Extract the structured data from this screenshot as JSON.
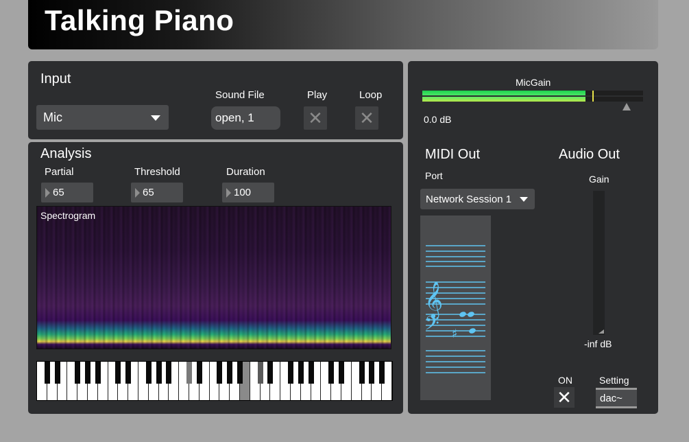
{
  "app": {
    "title": "Talking Piano"
  },
  "input": {
    "heading": "Input",
    "source_value": "Mic",
    "sound_file_label": "Sound File",
    "sound_file_value": "open, 1",
    "play_label": "Play",
    "loop_label": "Loop"
  },
  "analysis": {
    "heading": "Analysis",
    "partial_label": "Partial",
    "partial_value": "65",
    "threshold_label": "Threshold",
    "threshold_value": "65",
    "duration_label": "Duration",
    "duration_value": "100",
    "spectrogram_label": "Spectrogram"
  },
  "mic": {
    "label": "MicGain",
    "readout": "0.0 dB",
    "level": 0.74
  },
  "midi_out": {
    "heading": "MIDI Out",
    "port_label": "Port",
    "port_value": "Network Session 1"
  },
  "audio_out": {
    "heading": "Audio Out",
    "gain_label": "Gain",
    "gain_readout": "-inf dB",
    "on_label": "ON",
    "setting_label": "Setting",
    "setting_value": "dac~"
  },
  "colors": {
    "panel": "#2c2d2f",
    "background": "#a4a4a4",
    "meter_green": "#1dd14f",
    "staff_blue": "#5fc4f2"
  },
  "icons": {
    "dropdown": "chevron-down-icon",
    "toggle_off": "x-icon",
    "treble_clef": "treble-clef-icon",
    "bass_clef": "bass-clef-icon"
  }
}
